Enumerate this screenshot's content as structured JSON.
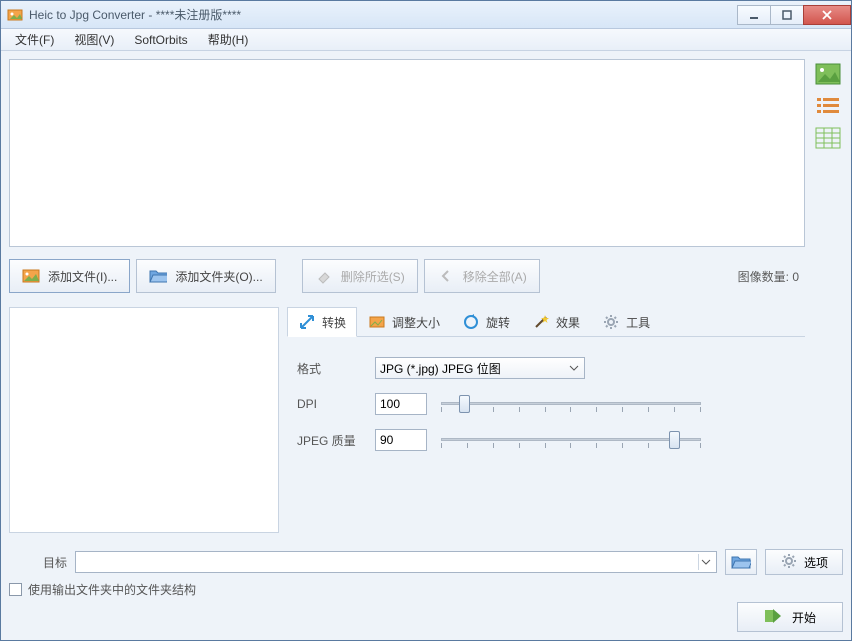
{
  "window": {
    "title": "Heic to Jpg Converter - ****未注册版****"
  },
  "menu": {
    "file": "文件(F)",
    "view": "视图(V)",
    "softorbits": "SoftOrbits",
    "help": "帮助(H)"
  },
  "toolbar": {
    "add_files": "添加文件(I)...",
    "add_folder": "添加文件夹(O)...",
    "remove_selected": "删除所选(S)",
    "remove_all": "移除全部(A)",
    "image_count_label": "图像数量: 0"
  },
  "tabs": {
    "convert": "转换",
    "resize": "调整大小",
    "rotate": "旋转",
    "effects": "效果",
    "tools": "工具"
  },
  "convert_panel": {
    "format_label": "格式",
    "format_value": "JPG (*.jpg) JPEG 位图",
    "dpi_label": "DPI",
    "dpi_value": "100",
    "jpeg_quality_label": "JPEG 质量",
    "jpeg_quality_value": "90"
  },
  "bottom": {
    "target_label": "目标",
    "target_value": "",
    "options": "选项",
    "use_folder_structure": "使用输出文件夹中的文件夹结构",
    "start": "开始"
  }
}
